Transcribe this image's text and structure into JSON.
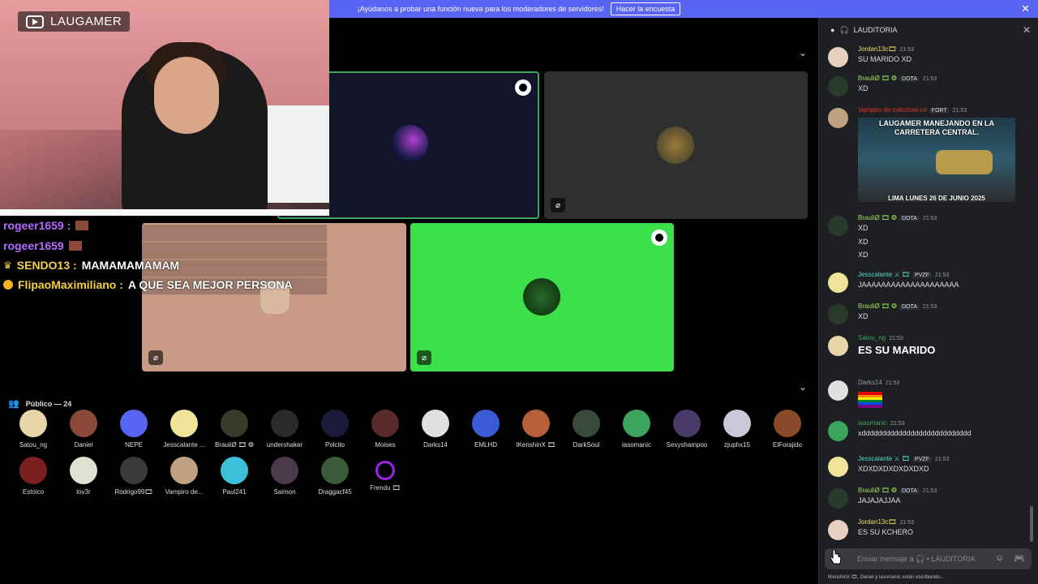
{
  "banner": {
    "text": "¡Ayúdanos a probar una función nueva para los moderadores de servidores!",
    "button": "Hacer la encuesta",
    "close": "✕"
  },
  "stream": {
    "logo_text": "LAUGAMER"
  },
  "overlay_chat": [
    {
      "user": "rogeer1659 :",
      "text": "",
      "kind": "emote"
    },
    {
      "user": "rogeer1659",
      "text": "",
      "kind": "emote"
    },
    {
      "user": "SENDO13 :",
      "text": "MAMAMAMAMAM",
      "kind": "crown"
    },
    {
      "user": "FlipaoMaximiliano :",
      "text": "A QUE SEA MEJOR PERSONA",
      "kind": "badge"
    }
  ],
  "audience": {
    "header": "Público — 24",
    "members": [
      {
        "name": "Satou_ng",
        "color": "#e8d5a8"
      },
      {
        "name": "Daniel",
        "color": "#8a4a3a"
      },
      {
        "name": "NEPE",
        "color": "#5865f2"
      },
      {
        "name": "Jesscalante ...",
        "color": "#f0e39a"
      },
      {
        "name": "BrauliØ 🎞 ❂",
        "color": "#3a3a2a"
      },
      {
        "name": "undershaker",
        "color": "#2a2a2a"
      },
      {
        "name": "Polcito",
        "color": "#1a1a3a"
      },
      {
        "name": "Moises",
        "color": "#5a2a2a"
      },
      {
        "name": "Darks14",
        "color": "#e0e0e0"
      },
      {
        "name": "EMLHD",
        "color": "#3a5bd8"
      },
      {
        "name": "lKenshinX 🎞",
        "color": "#b8603a"
      },
      {
        "name": "DarkSoul",
        "color": "#3a4a3a"
      },
      {
        "name": "iasomanic",
        "color": "#3ba55d"
      },
      {
        "name": "Sexyshampoo",
        "color": "#4a3a6a"
      },
      {
        "name": "zjuphx15",
        "color": "#c8c8d8"
      },
      {
        "name": "ElForajido",
        "color": "#8a4a2a"
      },
      {
        "name": "Estoico",
        "color": "#7a2020"
      },
      {
        "name": "lov3r",
        "color": "#e0e0d0"
      },
      {
        "name": "Rodrigo99🎞",
        "color": "#3a3a3a"
      },
      {
        "name": "Vampiro de...",
        "color": "#c0a080"
      },
      {
        "name": "Paul241",
        "color": "#3ac0d8"
      },
      {
        "name": "Saimon",
        "color": "#4a3a4a"
      },
      {
        "name": "Draggacf45",
        "color": "#3a5a3a"
      },
      {
        "name": "Frendu 🎞",
        "color": "#000000"
      }
    ]
  },
  "panel": {
    "title": "LAUDITORIA",
    "close": "✕"
  },
  "messages": [
    {
      "user": "Jordan13c🎞",
      "color": "#f0e060",
      "time": "21:53",
      "text": "SU MARIDO XD",
      "avatar": "#e8d0c0"
    },
    {
      "user": "BrauliØ 🎞 ❂",
      "color": "#9de05a",
      "tag": "DOTA",
      "time": "21:53",
      "text": "XD",
      "avatar": "#2a3a2a"
    },
    {
      "user": "Vampiro de colochas co",
      "color": "#e0372d",
      "tag": "FORT",
      "time": "21:53",
      "text": "",
      "avatar": "#c0a080"
    },
    {
      "user": "BrauliØ 🎞 ❂",
      "color": "#9de05a",
      "tag": "DOTA",
      "time": "21:53",
      "text": "XD",
      "avatar": "#2a3a2a"
    },
    {
      "user": "Jesscalante ⚔ 🎞",
      "color": "#56d8c8",
      "tag": "PVZF",
      "time": "21:53",
      "text": "JAAAAAAAAAAAAAAAAAAAA",
      "avatar": "#f0e39a"
    },
    {
      "user": "BrauliØ 🎞 ❂",
      "color": "#9de05a",
      "tag": "DOTA",
      "time": "21:53",
      "text": "XD",
      "avatar": "#2a3a2a"
    },
    {
      "user": "Satou_ng",
      "color": "#3ba55d",
      "time": "21:53",
      "text": "ES SU MARIDO",
      "avatar": "#e8d5a8"
    },
    {
      "user": "Darks14",
      "color": "#949ba4",
      "time": "21:53",
      "text": "",
      "avatar": "#e0e0e0"
    },
    {
      "user": "iasomanic",
      "color": "#3ba55d",
      "time": "21:53",
      "text": "xddddddddddddddddddddddddddd",
      "avatar": "#3ba55d"
    },
    {
      "user": "Jesscalante ⚔ 🎞",
      "color": "#56d8c8",
      "tag": "PVZF",
      "time": "21:53",
      "text": "XDXDXDXDXDXDXD",
      "avatar": "#f0e39a"
    },
    {
      "user": "BrauliØ 🎞 ❂",
      "color": "#9de05a",
      "tag": "DOTA",
      "time": "21:53",
      "text": "JAJAJAJJAA",
      "avatar": "#2a3a2a"
    },
    {
      "user": "Jordan13c🎞",
      "color": "#f0e060",
      "time": "21:53",
      "text": "ES SU KCHERO",
      "avatar": "#e8d0c0"
    }
  ],
  "extra_lines": {
    "xd2": "XD",
    "xd3": "XD"
  },
  "meme": {
    "top": "LAUGAMER MANEJANDO EN LA CARRETERA CENTRAL.",
    "bottom": "LIMA LUNES 26 DE JUNIO 2025"
  },
  "input": {
    "placeholder": "Enviar mensaje a 🎧 • LAUDITORIA"
  },
  "typing": "lKenshinX 🎞, Daniel y iasomanic están escribiendo..."
}
